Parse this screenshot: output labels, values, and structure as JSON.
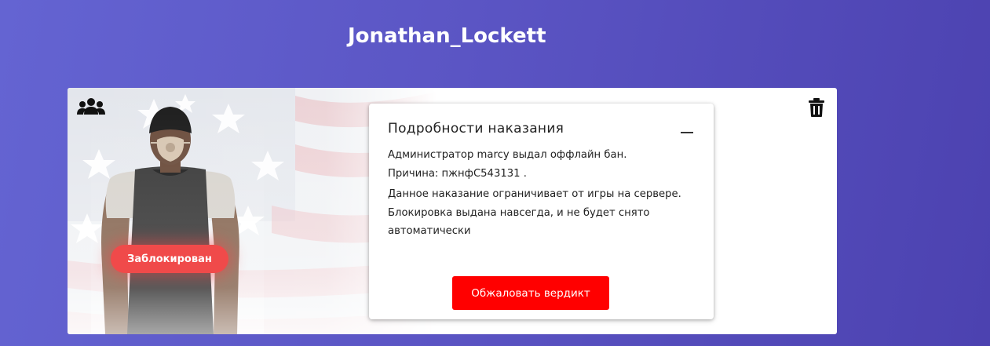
{
  "header": {
    "title": "Jonathan_Lockett"
  },
  "card": {
    "status_badge": "Заблокирован",
    "icons": {
      "group": "users-group-icon",
      "delete": "trash-icon"
    }
  },
  "details": {
    "title": "Подробности наказания",
    "collapse_symbol": "—",
    "line_admin": "Администратор marcy выдал оффлайн бан.",
    "line_reason": "Причина: пжнфС543131 .",
    "description": "Данное наказание ограничивает от игры на сервере. Блокировка выдана навсегда, и не будет снято автоматически",
    "appeal_button": "Обжаловать вердикт"
  },
  "colors": {
    "background_start": "#6464d2",
    "background_end": "#4c42b0",
    "badge": "#f04a4a",
    "appeal_button": "#ff0000"
  }
}
